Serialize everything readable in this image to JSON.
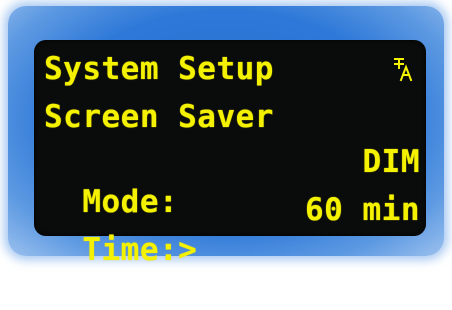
{
  "display": {
    "title": "System Setup",
    "menu_item": "Screen Saver",
    "mode_label": "Mode:",
    "mode_value": "DIM",
    "time_label": "Time:>",
    "time_value": "60 min"
  },
  "icons": {
    "language_icon": "font-language-icon"
  },
  "colors": {
    "text": "#f4f200",
    "screen_bg": "#0a0b0b",
    "bezel": "#2d78d8"
  }
}
